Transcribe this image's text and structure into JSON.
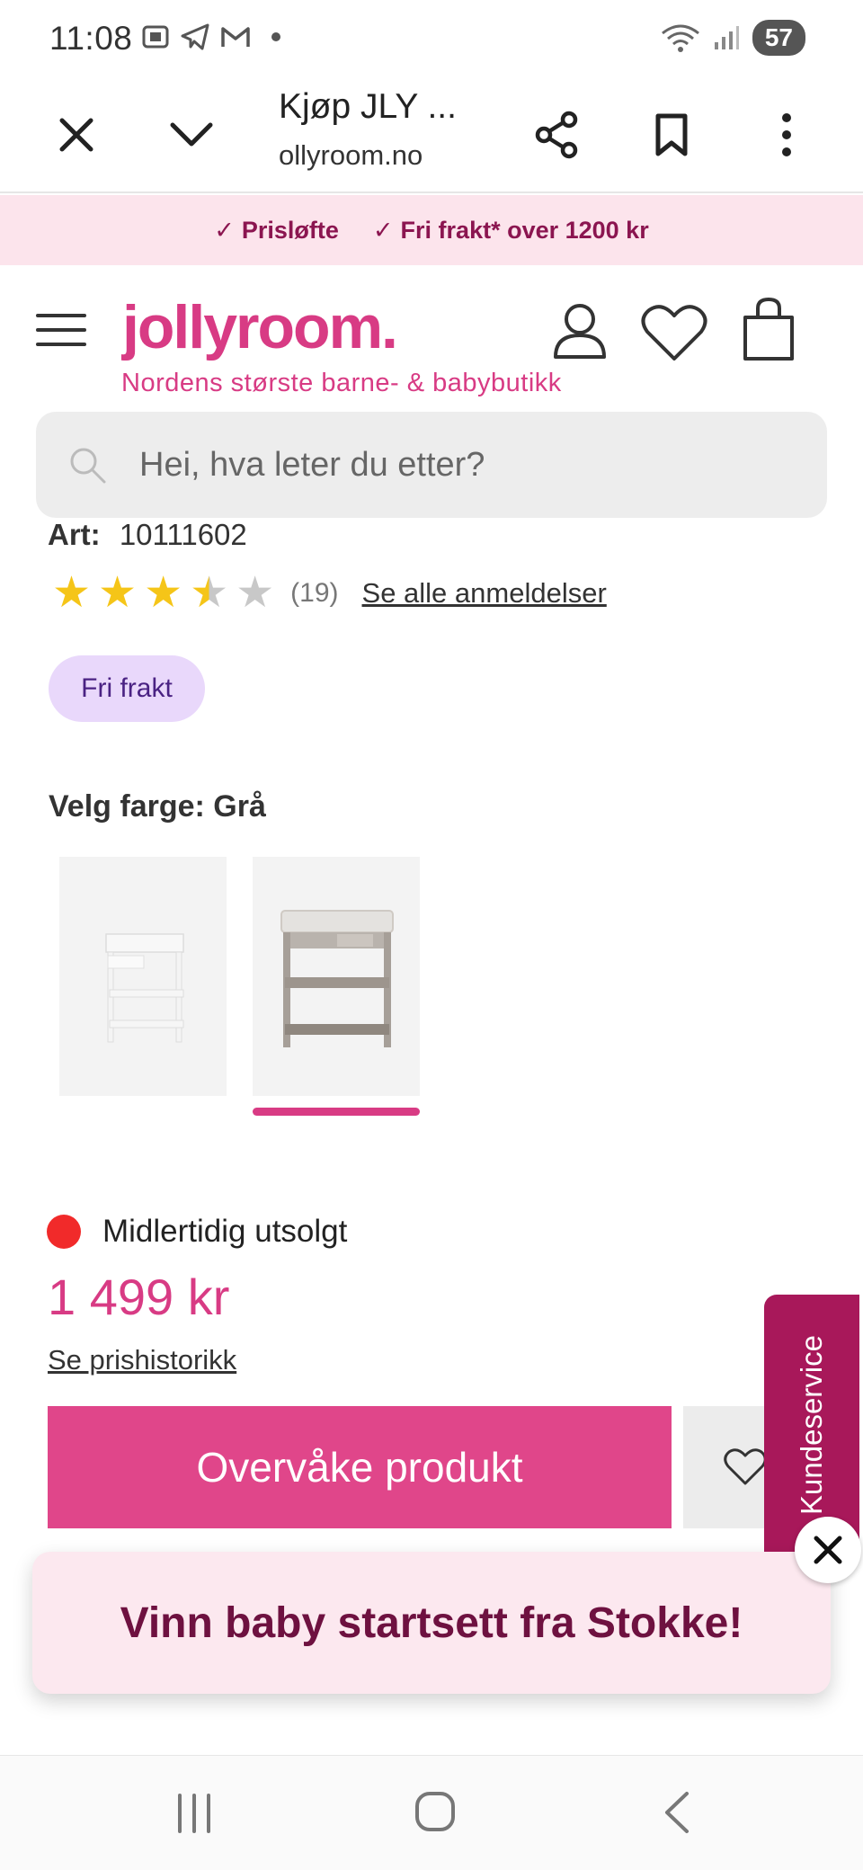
{
  "status_bar": {
    "time": "11:08",
    "network": "6E",
    "battery": "57"
  },
  "browser": {
    "tab_title": "Kjøp JLY ...",
    "url": "ollyroom.no"
  },
  "promo": {
    "items": [
      "Prisløfte",
      "Fri frakt* over 1200 kr"
    ],
    "check_glyph": "✓"
  },
  "site": {
    "logo": "jollyroom.",
    "tagline": "Nordens største barne- & babybutikk",
    "search_placeholder": "Hei, hva leter du etter?"
  },
  "product": {
    "art_label": "Art:",
    "art_number": "10111602",
    "rating": 3.5,
    "rating_max": 5,
    "review_count": "(19)",
    "reviews_link": "Se alle anmeldelser",
    "badge": "Fri frakt",
    "color_label": "Velg farge: Grå",
    "swatches": [
      {
        "name": "Hvit",
        "selected": false
      },
      {
        "name": "Grå",
        "selected": true
      }
    ],
    "stock_status": "Midlertidig utsolgt",
    "price": "1 499 kr",
    "price_history_link": "Se prishistorikk",
    "watch_button": "Overvåke produkt"
  },
  "overlay": {
    "kundeservice": "Kundeservice",
    "banner_text": "Vinn baby startsett fra Stokke!"
  },
  "colors": {
    "brand": "#d83b84",
    "button": "#e0468a",
    "promo_bg": "#fce4ec",
    "badge_bg": "#e9d8fb",
    "stock_red": "#f12a2a",
    "kundeservice_bg": "#a8185a",
    "star": "#f5c518"
  }
}
